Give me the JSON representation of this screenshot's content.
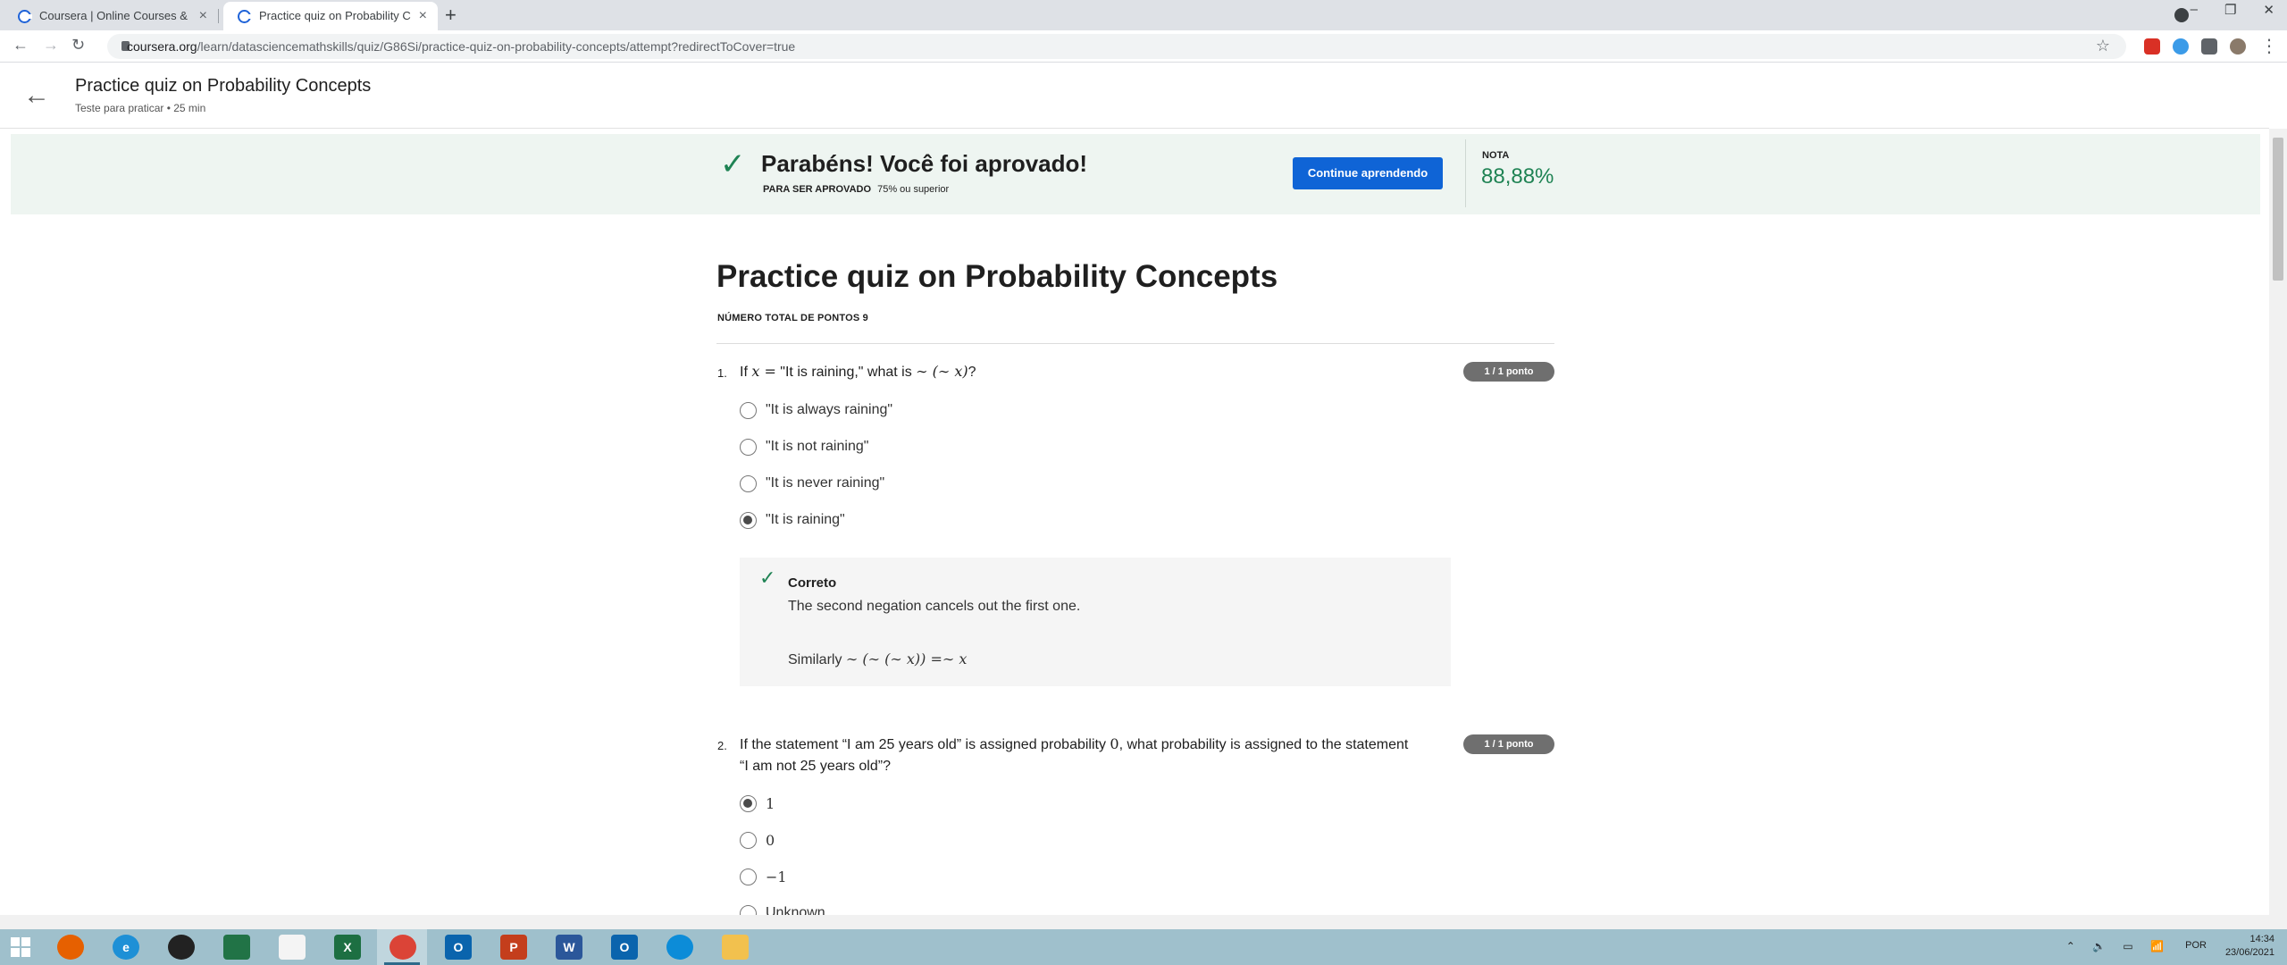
{
  "browser": {
    "tabs": [
      {
        "title": "Coursera | Online Courses & Credentials",
        "active": false
      },
      {
        "title": "Practice quiz on Probability Concepts",
        "active": true
      }
    ],
    "new_tab": "+",
    "close_glyph": "×",
    "url_host": "coursera.org",
    "url_path": "/learn/datasciencemathskills/quiz/G86Si/practice-quiz-on-probability-concepts/attempt?redirectToCover=true",
    "nav_back": "←",
    "nav_forward": "→",
    "nav_reload": "↻",
    "star": "☆",
    "menu": "⋮",
    "win_min": "–",
    "win_restore": "❐",
    "win_close": "✕"
  },
  "header": {
    "title": "Practice quiz on Probability Concepts",
    "subtitle": "Teste para praticar • 25 min",
    "back": "←"
  },
  "banner": {
    "check": "✓",
    "title": "Parabéns! Você foi aprovado!",
    "req_label": "PARA SER APROVADO",
    "req_value": "75% ou superior",
    "continue_label": "Continue aprendendo",
    "grade_label": "NOTA",
    "grade_value": "88,88%"
  },
  "quiz": {
    "title": "Practice quiz on Probability Concepts",
    "total_points": "NÚMERO TOTAL DE PONTOS 9",
    "questions": [
      {
        "number": "1.",
        "text_pre": "If ",
        "math1": "x =",
        "text_mid": " \"It is raining,\" what is ",
        "math2": "∼ (∼ x)",
        "text_post": "?",
        "score": "1 / 1 ponto",
        "options": [
          {
            "label": "\"It is always raining\"",
            "checked": false
          },
          {
            "label": "\"It is not raining\"",
            "checked": false
          },
          {
            "label": "\"It is never raining\"",
            "checked": false
          },
          {
            "label": "\"It is raining\"",
            "checked": true
          }
        ],
        "feedback": {
          "check": "✓",
          "title": "Correto",
          "text": "The second negation cancels out the first one.",
          "similarly": "Similarly ",
          "similarly_math": "∼ (∼ (∼ x)) =∼ x"
        }
      },
      {
        "number": "2.",
        "text_pre": "If the statement “I am 25 years old” is assigned probability ",
        "math1": "0",
        "text_post": ", what probability is assigned to the statement",
        "text_line2": "“I am not 25 years old”?",
        "score": "1 / 1 ponto",
        "options": [
          {
            "label": "1",
            "checked": true
          },
          {
            "label": "0",
            "checked": false
          },
          {
            "label": "−1",
            "checked": false
          },
          {
            "label": "Unknown",
            "checked": false
          }
        ]
      }
    ]
  },
  "taskbar": {
    "apps": [
      "start",
      "firefox",
      "internet-explorer",
      "obs",
      "project",
      "file",
      "excel",
      "chrome",
      "outlook",
      "powerpoint",
      "word",
      "outlook-2",
      "edge",
      "file-explorer"
    ],
    "lang": "POR",
    "time": "14:34",
    "date": "23/06/2021",
    "tray_icons": "⌃ 🔈 ▭ 📶"
  },
  "colors": {
    "accent": "#0f64d6",
    "success": "#1f8354",
    "banner_bg": "#eef5f1",
    "pill_bg": "#6f6f6f"
  }
}
